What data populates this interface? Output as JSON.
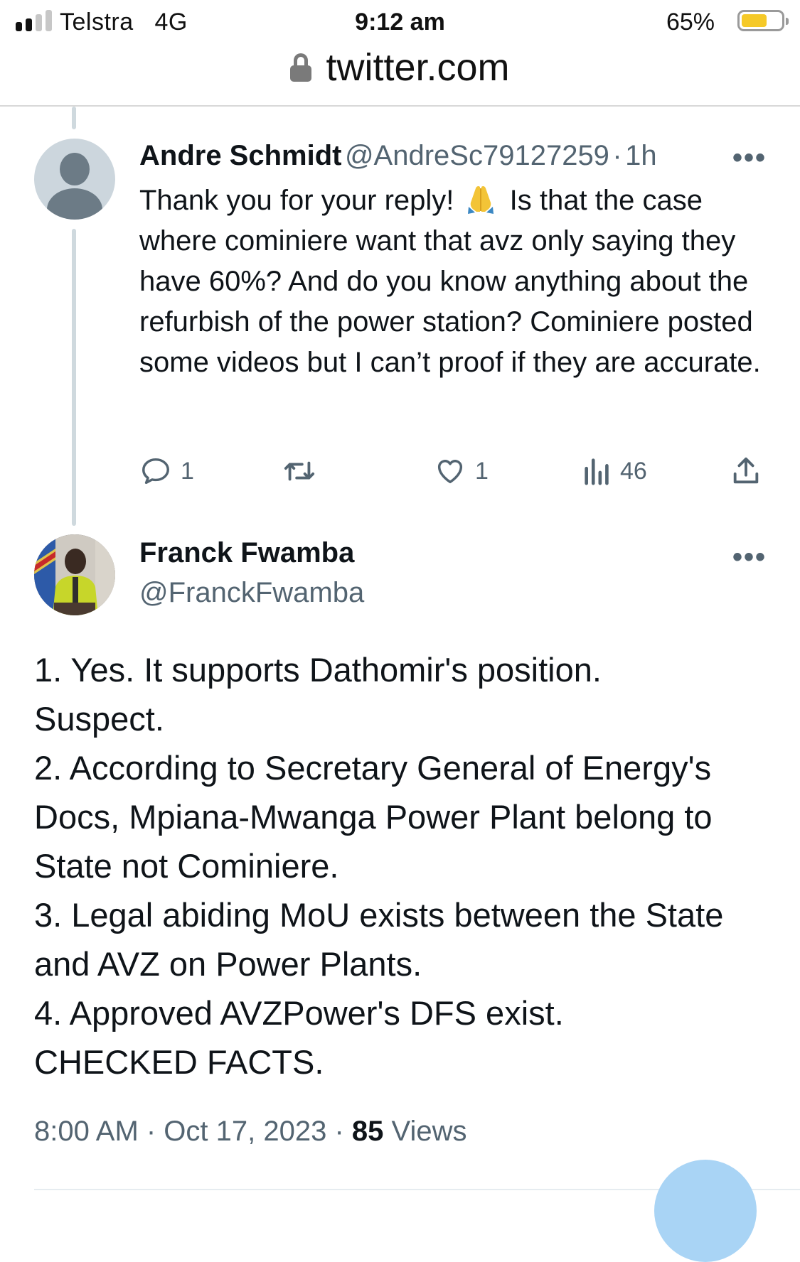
{
  "status_bar": {
    "carrier": "Telstra",
    "network": "4G",
    "time": "9:12 am",
    "battery_percent": "65%",
    "battery_level": 0.65,
    "battery_color": "#f5c928",
    "signal_bars_filled": 2,
    "signal_bars_total": 4
  },
  "url_bar": {
    "icon": "lock-icon",
    "url": "twitter.com"
  },
  "tweet_reply": {
    "author_name": "Andre Schmidt",
    "author_handle": "@AndreSc79127259",
    "separator": "·",
    "age": "1h",
    "more_label": "•••",
    "avatar_icon": "default-profile-icon",
    "text_before_emoji": "Thank you for your reply!",
    "emoji": "folded-hands-emoji",
    "text_after_emoji": "Is that the case where cominiere want that avz only saying they have 60%? And do you know anything about the refurbish of the power station? Cominiere posted some videos but I can’t proof if they are accurate.",
    "actions": {
      "replies": "1",
      "retweets": "",
      "likes": "1",
      "views": "46"
    }
  },
  "tweet_main": {
    "author_name": "Franck Fwamba",
    "author_handle": "@FranckFwamba",
    "more_label": "•••",
    "lines": [
      "1. Yes. It supports Dathomir's position.",
      "Suspect.",
      "2. According to Secretary General of Energy's Docs, Mpiana-Mwanga Power Plant belong to State not Cominiere.",
      "3. Legal abiding MoU exists between the State and AVZ on Power Plants.",
      "4. Approved AVZPower's DFS exist.",
      "CHECKED FACTS."
    ],
    "timestamp": "8:00 AM · Oct 17, 2023 · ",
    "views_count": "85",
    "views_label": " Views"
  },
  "colors": {
    "accent": "#1d9bf0",
    "secondary_text": "#536471",
    "thread_line": "#cfd9de",
    "fab": "#a9d4f5"
  }
}
